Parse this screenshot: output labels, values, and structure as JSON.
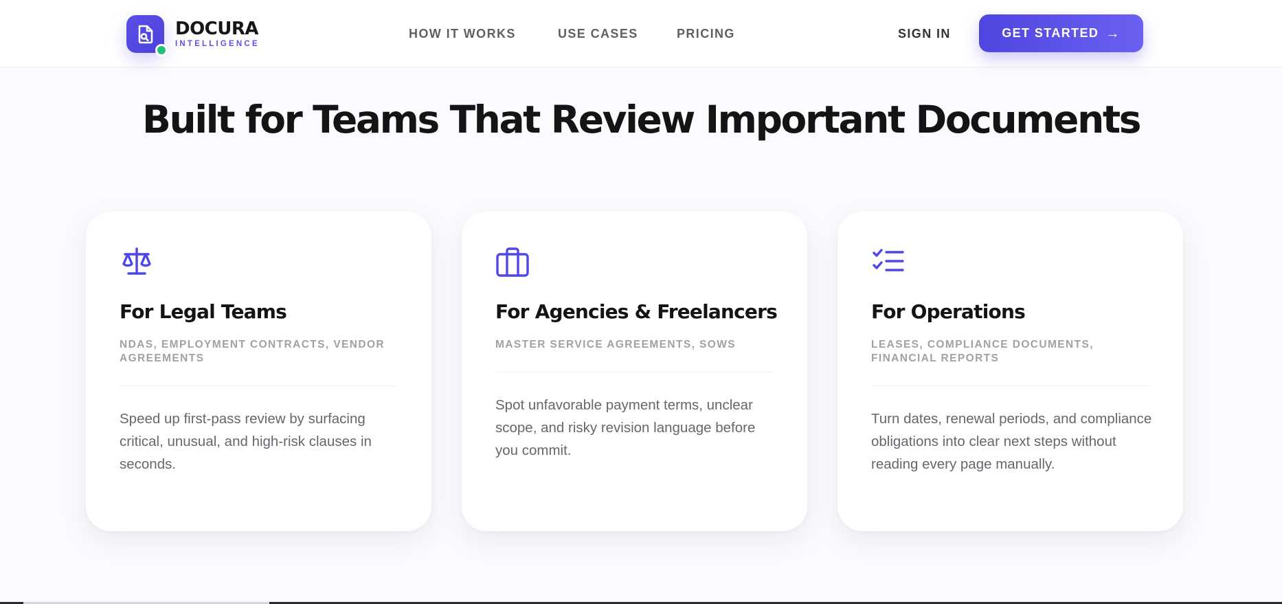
{
  "brand": {
    "name": "DOCURA",
    "tagline": "INTELLIGENCE",
    "accent": "#5a50e6",
    "status_dot": "#22c07a"
  },
  "nav": {
    "items": [
      "HOW IT WORKS",
      "USE CASES",
      "PRICING"
    ],
    "sign_in": "SIGN IN",
    "cta": "GET STARTED",
    "cta_icon": "arrow-right-icon"
  },
  "section": {
    "title": "Built for Teams That Review Important Documents"
  },
  "cards": [
    {
      "icon": "scale-icon",
      "title": "For Legal Teams",
      "tag": "NDAS, EMPLOYMENT CONTRACTS, VENDOR AGREEMENTS",
      "description": "Speed up first-pass review by surfacing critical, unusual, and high-risk clauses in seconds."
    },
    {
      "icon": "briefcase-icon",
      "title": "For Agencies & Freelancers",
      "tag": "MASTER SERVICE AGREEMENTS, SOWS",
      "description": "Spot unfavorable payment terms, unclear scope, and risky revision language before you commit."
    },
    {
      "icon": "checklist-icon",
      "title": "For Operations",
      "tag": "LEASES, COMPLIANCE DOCUMENTS, FINANCIAL REPORTS",
      "description": "Turn dates, renewal periods, and compliance obligations into clear next steps without reading every page manually."
    }
  ]
}
